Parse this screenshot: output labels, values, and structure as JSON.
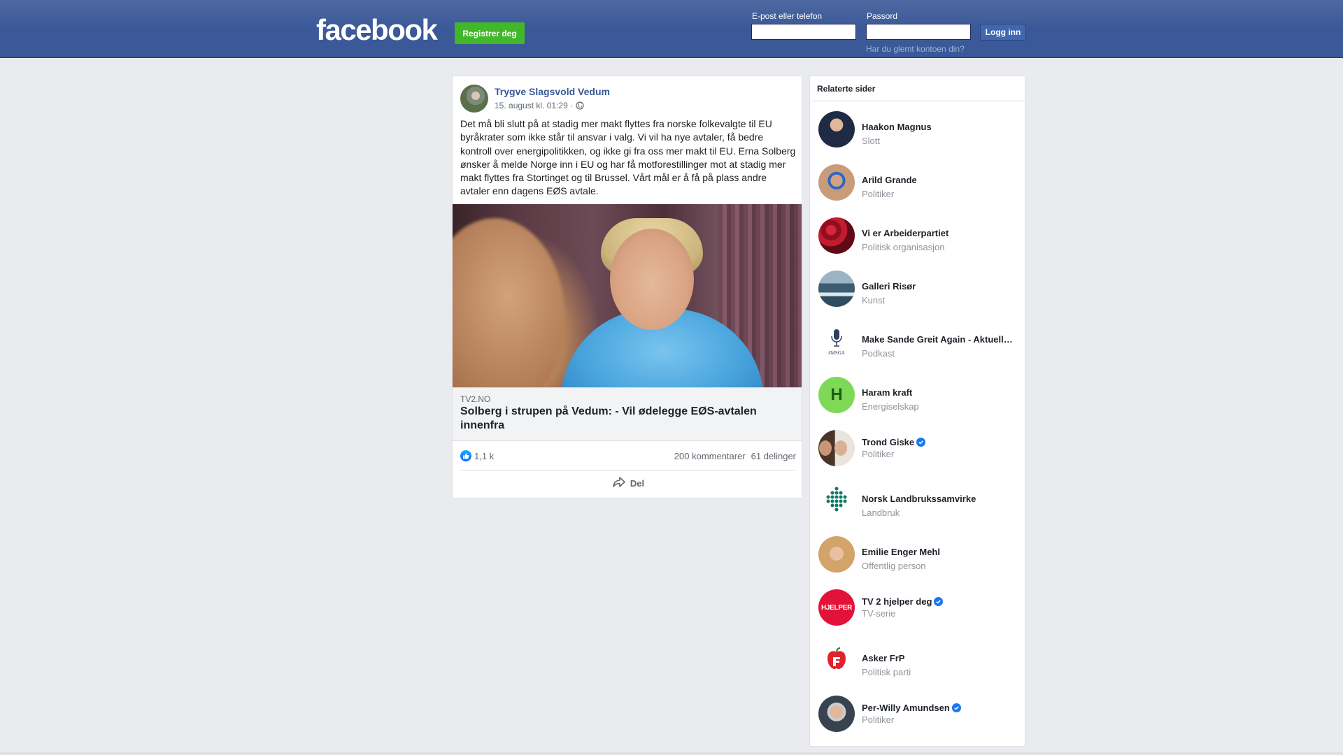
{
  "header": {
    "logo": "facebook",
    "register_label": "Registrer deg",
    "email_label": "E-post eller telefon",
    "password_label": "Passord",
    "login_label": "Logg inn",
    "forgot_label": "Har du glemt kontoen din?",
    "colors": {
      "bar": "#3b5998",
      "register": "#42b72a"
    }
  },
  "post": {
    "author": "Trygve Slagsvold Vedum",
    "timestamp": "15. august kl. 01:29 ·",
    "privacy_icon": "globe-icon",
    "text": "Det må bli slutt på at stadig mer makt flyttes fra norske folkevalgte til EU byråkrater som ikke står til ansvar i valg. Vi vil ha nye avtaler, få bedre kontroll over energipolitikken, og ikke gi fra oss mer makt til EU. Erna Solberg ønsker å melde Norge inn i EU og har få motforestillinger mot at stadig mer makt flyttes fra Stortinget og til Brussel. Vårt mål er å få på plass andre avtaler enn dagens EØS avtale.",
    "link": {
      "domain": "TV2.NO",
      "title": "Solberg i strupen på Vedum: - Vil ødelegge EØS-avtalen innenfra"
    },
    "reactions": {
      "likes": "1,1 k",
      "comments": "200 kommentarer",
      "shares": "61 delinger"
    },
    "share_label": "Del"
  },
  "related": {
    "title": "Relaterte sider",
    "items": [
      {
        "name": "Haakon Magnus",
        "category": "Slott",
        "verified": false
      },
      {
        "name": "Arild Grande",
        "category": "Politiker",
        "verified": false
      },
      {
        "name": "Vi er Arbeiderpartiet",
        "category": "Politisk organisasjon",
        "verified": false
      },
      {
        "name": "Galleri Risør",
        "category": "Kunst",
        "verified": false
      },
      {
        "name": "Make Sande Greit Again - Aktuell…",
        "category": "Podkast",
        "verified": false,
        "avatar_text": "#MSGA"
      },
      {
        "name": "Haram kraft",
        "category": "Energiselskap",
        "verified": false,
        "avatar_text": "H"
      },
      {
        "name": "Trond Giske",
        "category": "Politiker",
        "verified": true
      },
      {
        "name": "Norsk Landbrukssamvirke",
        "category": "Landbruk",
        "verified": false
      },
      {
        "name": "Emilie Enger Mehl",
        "category": "Offentlig person",
        "verified": false
      },
      {
        "name": "TV 2 hjelper deg",
        "category": "TV-serie",
        "verified": true,
        "avatar_text": "HJELPER"
      },
      {
        "name": "Asker FrP",
        "category": "Politisk parti",
        "verified": false
      },
      {
        "name": "Per-Willy Amundsen",
        "category": "Politiker",
        "verified": true
      }
    ]
  }
}
